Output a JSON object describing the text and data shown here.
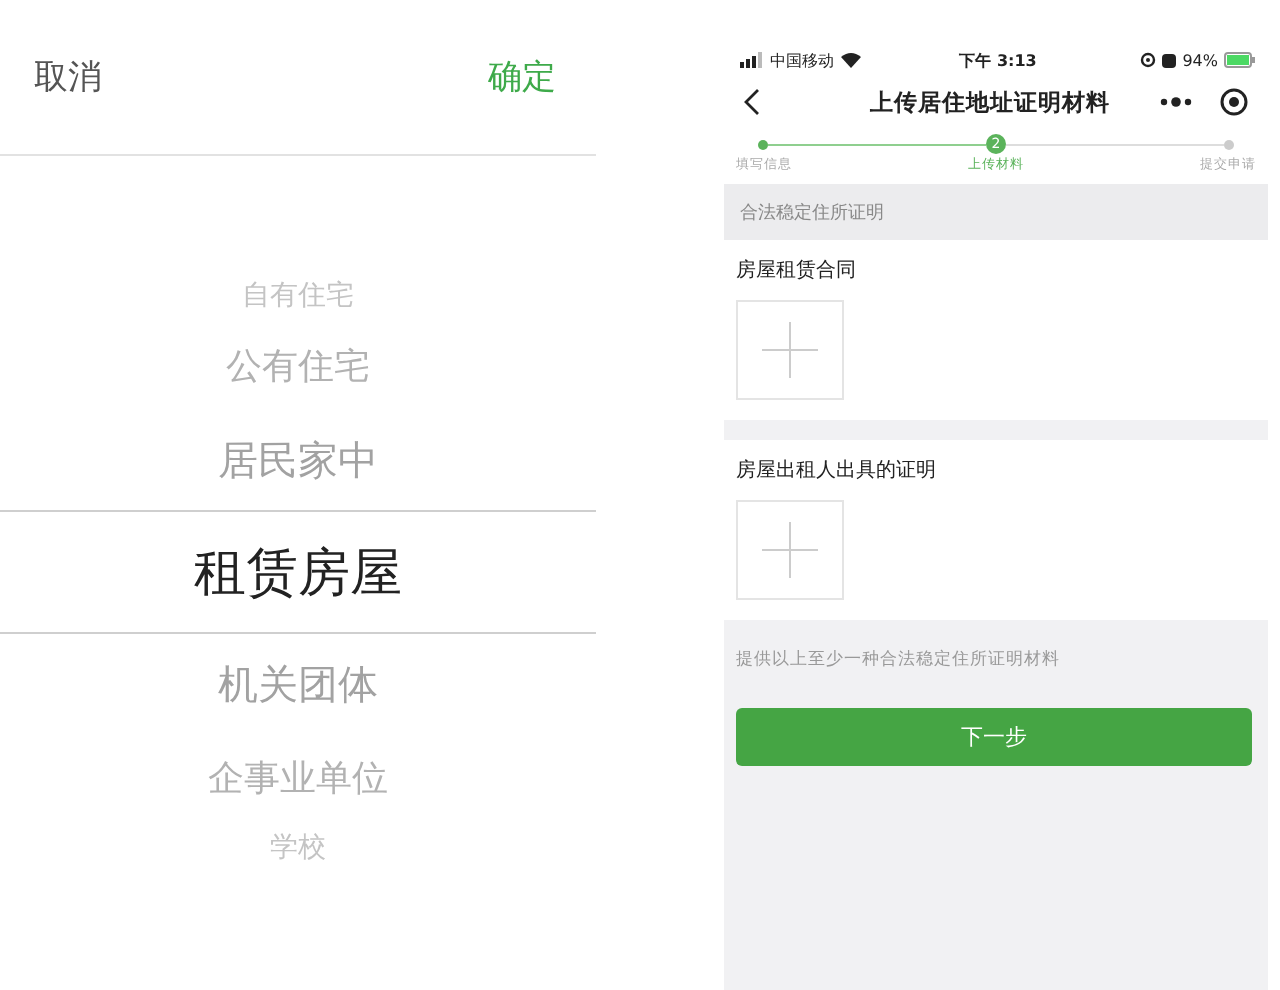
{
  "picker": {
    "cancel": "取消",
    "confirm": "确定",
    "options": [
      {
        "label": "自有住宅",
        "selected": false
      },
      {
        "label": "公有住宅",
        "selected": false
      },
      {
        "label": "居民家中",
        "selected": false
      },
      {
        "label": "租赁房屋",
        "selected": true
      },
      {
        "label": "机关团体",
        "selected": false
      },
      {
        "label": "企事业单位",
        "selected": false
      },
      {
        "label": "学校",
        "selected": false
      }
    ]
  },
  "status_bar": {
    "carrier": "中国移动",
    "time": "下午 3:13",
    "battery": "94%"
  },
  "nav": {
    "title": "上传居住地址证明材料"
  },
  "steps": [
    {
      "label": "填写信息",
      "kind": "done"
    },
    {
      "label": "上传材料",
      "kind": "current",
      "number": "2"
    },
    {
      "label": "提交申请",
      "kind": "todo"
    }
  ],
  "section_header": "合法稳定住所证明",
  "uploads": [
    {
      "label": "房屋租赁合同"
    },
    {
      "label": "房屋出租人出具的证明"
    }
  ],
  "hint": "提供以上至少一种合法稳定住所证明材料",
  "next_button": "下一步"
}
